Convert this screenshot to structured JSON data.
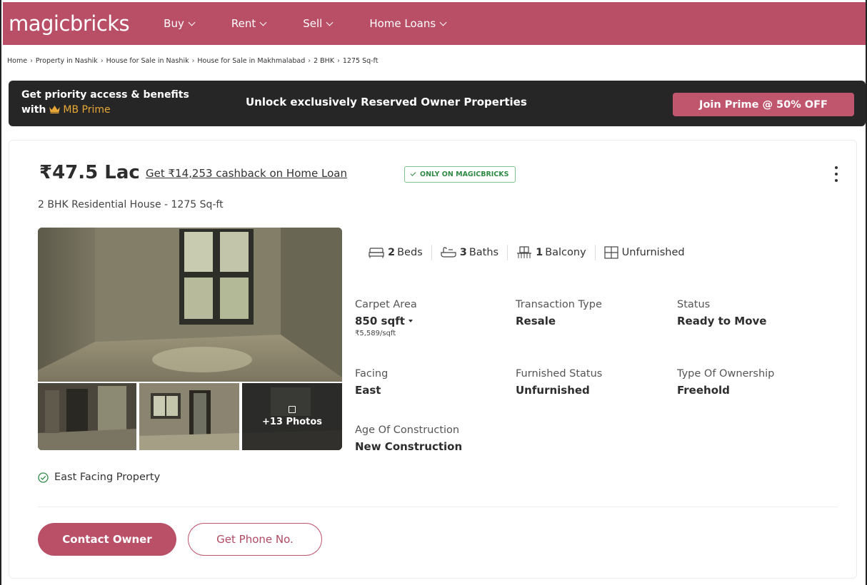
{
  "header": {
    "logo": "magicbricks",
    "nav": [
      {
        "label": "Buy"
      },
      {
        "label": "Rent"
      },
      {
        "label": "Sell"
      },
      {
        "label": "Home Loans"
      }
    ]
  },
  "breadcrumb": [
    "Home",
    "Property in Nashik",
    "House for Sale in Nashik",
    "House for Sale in Makhmalabad",
    "2 BHK",
    "1275 Sq-ft"
  ],
  "prime": {
    "line1": "Get priority access & benefits",
    "line2_prefix": "with",
    "brand": "MB Prime",
    "message": "Unlock exclusively Reserved Owner Properties",
    "cta": "Join Prime @ 50% OFF"
  },
  "listing": {
    "price": "₹47.5 Lac",
    "cashback": "Get ₹14,253 cashback on Home Loan",
    "badge": "ONLY ON MAGICBRICKS",
    "title": "2 BHK Residential House - 1275 Sq-ft",
    "photos_more": "+13 Photos",
    "features": [
      {
        "count": "2",
        "label": "Beds"
      },
      {
        "count": "3",
        "label": "Baths"
      },
      {
        "count": "1",
        "label": "Balcony"
      },
      {
        "count": "",
        "label": "Unfurnished"
      }
    ],
    "specs": {
      "carpet_area": {
        "label": "Carpet Area",
        "value": "850 sqft",
        "sub": "₹5,589/sqft"
      },
      "transaction": {
        "label": "Transaction Type",
        "value": "Resale"
      },
      "status": {
        "label": "Status",
        "value": "Ready to Move"
      },
      "facing": {
        "label": "Facing",
        "value": "East"
      },
      "furnished": {
        "label": "Furnished Status",
        "value": "Unfurnished"
      },
      "ownership": {
        "label": "Type Of Ownership",
        "value": "Freehold"
      },
      "age": {
        "label": "Age Of Construction",
        "value": "New Construction"
      }
    },
    "highlight": "East Facing Property",
    "contact_button": "Contact Owner",
    "phone_button": "Get Phone No."
  },
  "colors": {
    "brand": "#b94f67",
    "prime_bg": "#262626",
    "prime_gold": "#e8a736",
    "verified_green": "#2f8a45"
  }
}
